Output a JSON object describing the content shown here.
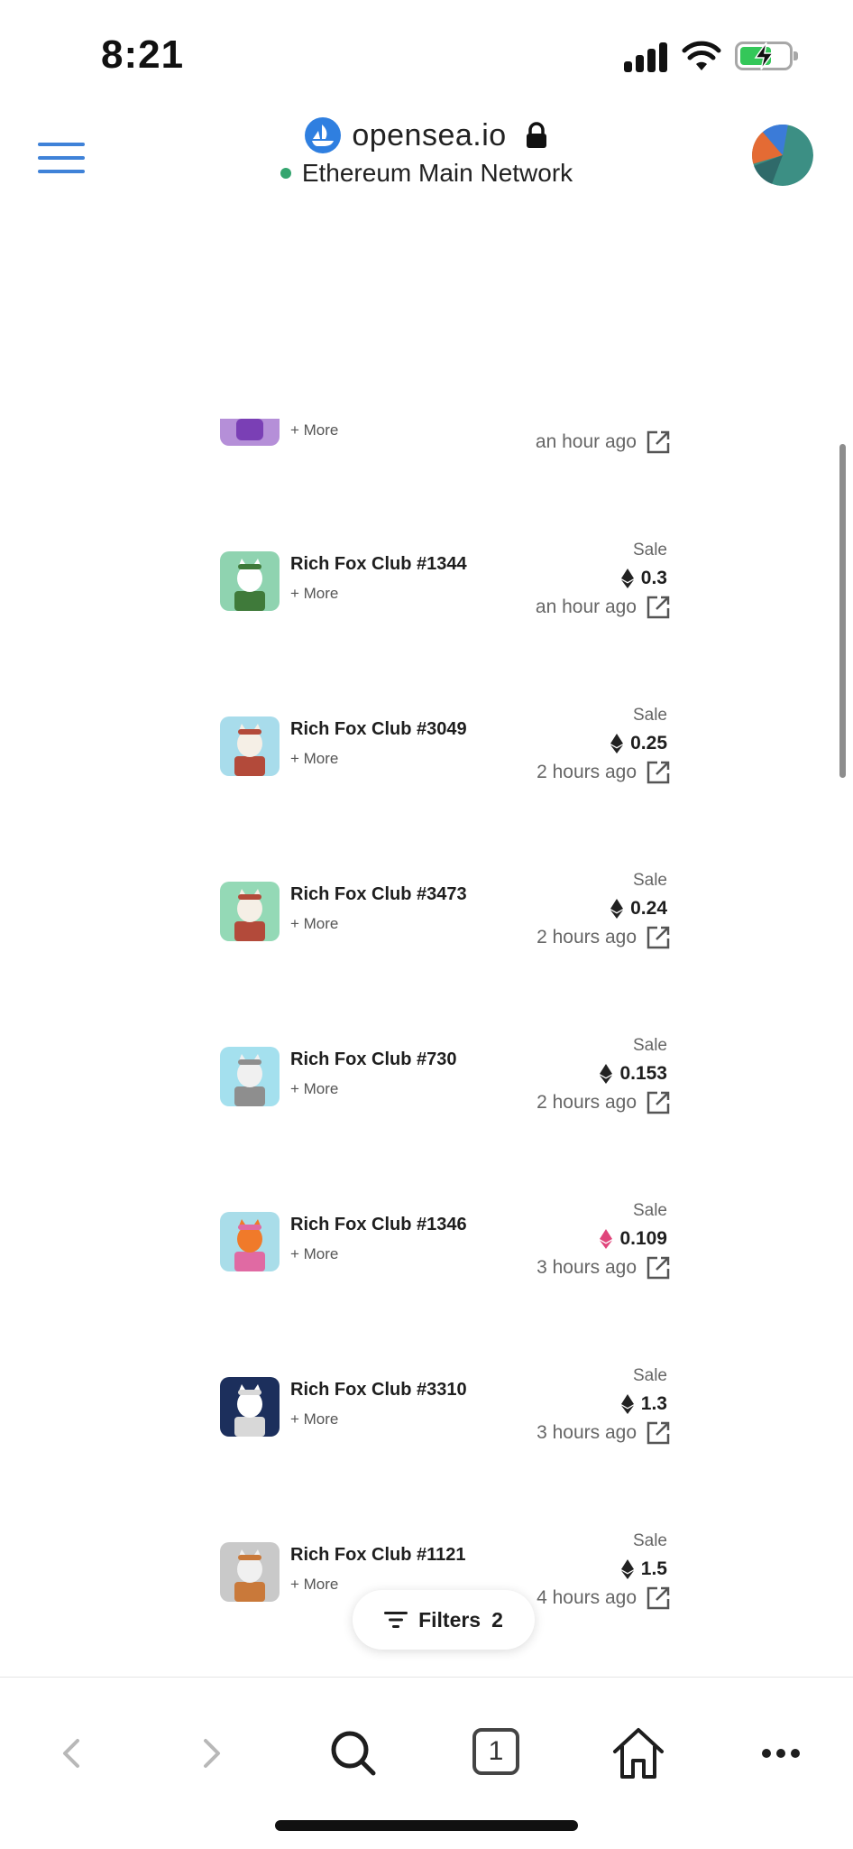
{
  "status_bar": {
    "time": "8:21",
    "icons": [
      "cellular-signal-icon",
      "wifi-icon",
      "battery-charging-icon"
    ]
  },
  "browser": {
    "site_url": "opensea.io",
    "network_label": "Ethereum Main Network",
    "network_status_color": "#34a56f",
    "accent_color": "#3f82d8",
    "icons": {
      "menu": "hamburger-menu-icon",
      "site_logo": "opensea-logo-icon",
      "lock": "lock-icon",
      "account": "account-avatar"
    }
  },
  "activity": {
    "partial_row": {
      "more": "+ More",
      "time": "an hour ago"
    },
    "rows": [
      {
        "name": "Rich Fox Club #1344",
        "more": "+ More",
        "event": "Sale",
        "price": "0.3",
        "currency": "ETH",
        "time": "an hour ago"
      },
      {
        "name": "Rich Fox Club #3049",
        "more": "+ More",
        "event": "Sale",
        "price": "0.25",
        "currency": "ETH",
        "time": "2 hours ago"
      },
      {
        "name": "Rich Fox Club #3473",
        "more": "+ More",
        "event": "Sale",
        "price": "0.24",
        "currency": "ETH",
        "time": "2 hours ago"
      },
      {
        "name": "Rich Fox Club #730",
        "more": "+ More",
        "event": "Sale",
        "price": "0.153",
        "currency": "ETH",
        "time": "2 hours ago"
      },
      {
        "name": "Rich Fox Club #1346",
        "more": "+ More",
        "event": "Sale",
        "price": "0.109",
        "currency": "WETH",
        "time": "3 hours ago"
      },
      {
        "name": "Rich Fox Club #3310",
        "more": "+ More",
        "event": "Sale",
        "price": "1.3",
        "currency": "ETH",
        "time": "3 hours ago"
      },
      {
        "name": "Rich Fox Club #1121",
        "more": "+ More",
        "event": "Sale",
        "price": "1.5",
        "currency": "ETH",
        "time": "4 hours ago"
      }
    ]
  },
  "filters": {
    "label": "Filters",
    "count": "2"
  },
  "toolbar": {
    "tab_count": "1",
    "icons": [
      "back-icon",
      "forward-icon",
      "search-icon",
      "tabs-icon",
      "home-icon",
      "more-icon"
    ]
  },
  "colors": {
    "eth": "#222222",
    "weth": "#e0457b"
  }
}
